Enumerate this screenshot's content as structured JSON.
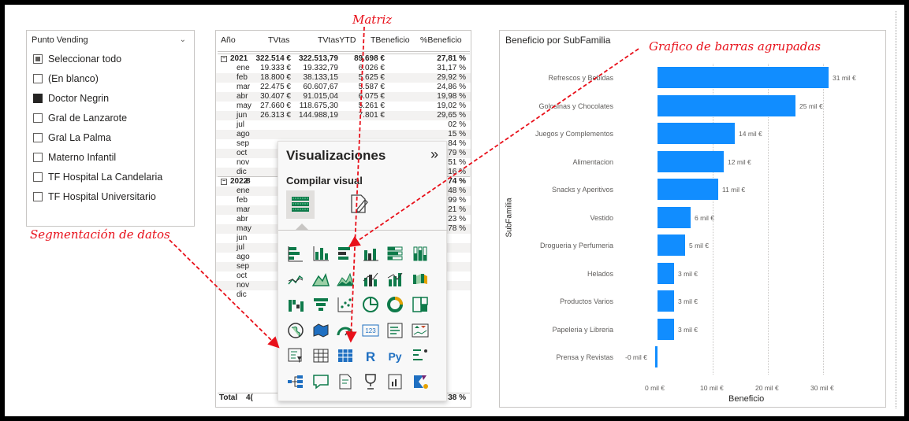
{
  "slicer": {
    "title": "Punto Vending",
    "items": [
      {
        "label": "Seleccionar todo",
        "state": "partial"
      },
      {
        "label": "(En blanco)",
        "state": "unchecked"
      },
      {
        "label": "Doctor Negrin",
        "state": "checked"
      },
      {
        "label": "Gral de Lanzarote",
        "state": "unchecked"
      },
      {
        "label": "Gral La Palma",
        "state": "unchecked"
      },
      {
        "label": "Materno Infantil",
        "state": "unchecked"
      },
      {
        "label": "TF Hospital La Candelaria",
        "state": "unchecked"
      },
      {
        "label": "TF Hospital Universitario",
        "state": "unchecked"
      }
    ]
  },
  "matrix": {
    "headers": [
      "Año",
      "TVtas",
      "TVtasYTD",
      "TBeneficio",
      "%Beneficio"
    ],
    "rows": [
      {
        "c": [
          "2021",
          "322.514 €",
          "322.513,79",
          "89.698 €",
          "27,81 %"
        ],
        "type": "year"
      },
      {
        "c": [
          "ene",
          "19.333 €",
          "19.332,79",
          "6.026 €",
          "31,17 %"
        ]
      },
      {
        "c": [
          "feb",
          "18.800 €",
          "38.133,15",
          "5.625 €",
          "29,92 %"
        ]
      },
      {
        "c": [
          "mar",
          "22.475 €",
          "60.607,67",
          "5.587 €",
          "24,86 %"
        ]
      },
      {
        "c": [
          "abr",
          "30.407 €",
          "91.015,04",
          "6.075 €",
          "19,98 %"
        ]
      },
      {
        "c": [
          "may",
          "27.660 €",
          "118.675,30",
          "5.261 €",
          "19,02 %"
        ]
      },
      {
        "c": [
          "jun",
          "26.313 €",
          "144.988,19",
          "7.801 €",
          "29,65 %"
        ]
      },
      {
        "c": [
          "jul",
          "",
          "",
          "",
          "02 %"
        ]
      },
      {
        "c": [
          "ago",
          "",
          "",
          "",
          "15 %"
        ]
      },
      {
        "c": [
          "sep",
          "",
          "",
          "",
          "84 %"
        ]
      },
      {
        "c": [
          "oct",
          "",
          "",
          "",
          "79 %"
        ]
      },
      {
        "c": [
          "nov",
          "",
          "",
          "",
          "51 %"
        ]
      },
      {
        "c": [
          "dic",
          "",
          "",
          "",
          "16 %"
        ]
      },
      {
        "c": [
          "2022",
          "8",
          "",
          "",
          "74 %"
        ],
        "type": "year"
      },
      {
        "c": [
          "ene",
          "",
          "",
          "",
          "48 %"
        ]
      },
      {
        "c": [
          "feb",
          "",
          "",
          "",
          "99 %"
        ]
      },
      {
        "c": [
          "mar",
          "",
          "",
          "",
          "21 %"
        ]
      },
      {
        "c": [
          "abr",
          "",
          "",
          "",
          "23 %"
        ]
      },
      {
        "c": [
          "may",
          "",
          "",
          "",
          "78 %"
        ]
      },
      {
        "c": [
          "jun",
          "",
          "",
          "",
          ""
        ]
      },
      {
        "c": [
          "jul",
          "",
          "",
          "",
          ""
        ]
      },
      {
        "c": [
          "ago",
          "",
          "",
          "",
          ""
        ]
      },
      {
        "c": [
          "sep",
          "",
          "",
          "",
          ""
        ]
      },
      {
        "c": [
          "oct",
          "",
          "",
          "",
          ""
        ]
      },
      {
        "c": [
          "nov",
          "",
          "",
          "",
          ""
        ]
      },
      {
        "c": [
          "dic",
          "",
          "",
          "",
          ""
        ]
      }
    ],
    "total": {
      "c": [
        "Total",
        "4(",
        "",
        "",
        "38 %"
      ]
    }
  },
  "visualizations": {
    "title": "Visualizaciones",
    "collapse": "»",
    "subtitle": "Compilar visual",
    "icons": [
      "stacked-bar-chart-icon",
      "stacked-column-chart-icon",
      "clustered-bar-chart-icon",
      "clustered-column-chart-icon",
      "100-stacked-bar-chart-icon",
      "100-stacked-column-chart-icon",
      "line-chart-icon",
      "area-chart-icon",
      "stacked-area-chart-icon",
      "line-clustered-column-chart-icon",
      "line-stacked-column-chart-icon",
      "ribbon-chart-icon",
      "waterfall-chart-icon",
      "funnel-chart-icon",
      "scatter-chart-icon",
      "pie-chart-icon",
      "donut-chart-icon",
      "treemap-icon",
      "map-icon",
      "filled-map-icon",
      "gauge-icon",
      "card-icon",
      "multi-row-card-icon",
      "kpi-icon",
      "slicer-icon",
      "table-icon",
      "matrix-icon",
      "r-visual-icon",
      "python-visual-icon",
      "key-influencers-icon",
      "decomposition-tree-icon",
      "qa-icon",
      "smart-narrative-icon",
      "metrics-icon",
      "paginated-report-icon",
      "power-apps-icon"
    ],
    "r_label": "R",
    "py_label": "Py",
    "card_label": "123"
  },
  "chart": {
    "title": "Beneficio por SubFamilia",
    "xlabel": "Beneficio",
    "ylabel": "SubFamilia"
  },
  "chart_data": {
    "type": "bar",
    "title": "Beneficio por SubFamilia",
    "xlabel": "Beneficio",
    "ylabel": "SubFamilia",
    "categories": [
      "Refrescos y Bebidas",
      "Golosinas y Chocolates",
      "Juegos y Complementos",
      "Alimentacion",
      "Snacks y Aperitivos",
      "Vestido",
      "Drogueria y Perfumeria",
      "Helados",
      "Productos Varios",
      "Papeleria y Libreria",
      "Prensa y Revistas"
    ],
    "values": [
      31,
      25,
      14,
      12,
      11,
      6,
      5,
      3,
      3,
      3,
      -0.3
    ],
    "data_labels": [
      "31 mil €",
      "25 mil €",
      "14 mil €",
      "12 mil €",
      "11 mil €",
      "6 mil €",
      "5 mil €",
      "3 mil €",
      "3 mil €",
      "3 mil €",
      "-0 mil €"
    ],
    "xticks": [
      "0 mil €",
      "10 mil €",
      "20 mil €",
      "30 mil €"
    ],
    "xtick_values": [
      0,
      10,
      20,
      30
    ],
    "xlim": [
      -0.3,
      34
    ],
    "color": "#118dff"
  },
  "annotations": {
    "matriz": "Matriz",
    "grafico": "Grafico de barras agrupadas",
    "segmentacion": "Segmentación de datos",
    "color": "#e8101a"
  }
}
